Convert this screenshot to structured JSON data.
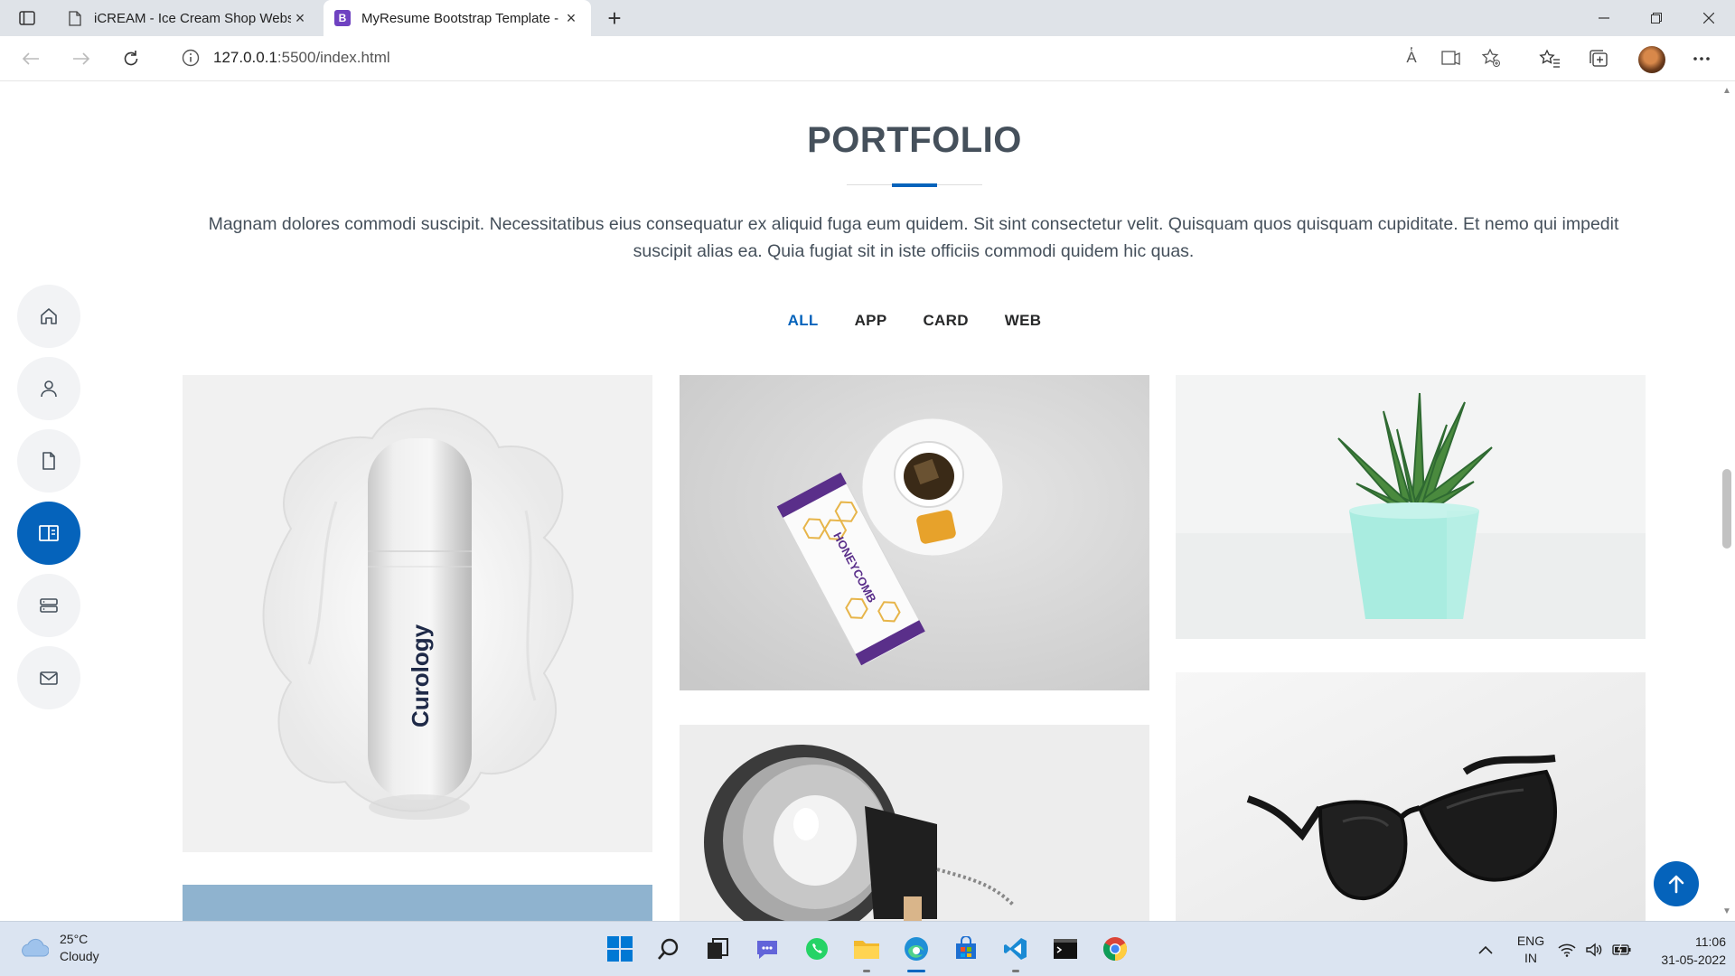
{
  "browser": {
    "tabs": [
      {
        "title": "iCREAM - Ice Cream Shop Websi",
        "favicon": "page-icon",
        "active": false
      },
      {
        "title": "MyResume Bootstrap Template -",
        "favicon": "bootstrap-icon",
        "favicon_letter": "B",
        "active": true
      }
    ],
    "new_tab_symbol": "+",
    "url_host": "127.0.0.1",
    "url_rest": ":5500/index.html",
    "read_aloud_symbol": "A̔"
  },
  "portfolio": {
    "title": "PORTFOLIO",
    "description": "Magnam dolores commodi suscipit. Necessitatibus eius consequatur ex aliquid fuga eum quidem. Sit sint consectetur velit. Quisquam quos quisquam cupiditate. Et nemo qui impedit suscipit alias ea. Quia fugiat sit in iste officiis commodi quidem hic quas.",
    "filters": [
      "ALL",
      "APP",
      "CARD",
      "WEB"
    ],
    "active_filter": "ALL",
    "items": [
      {
        "name": "curology-bottle",
        "label": "Curology"
      },
      {
        "name": "honeycomb-pack",
        "label": "HONEYCOMB"
      },
      {
        "name": "succulent-plant"
      },
      {
        "name": "desk-lamp"
      },
      {
        "name": "sunglasses"
      },
      {
        "name": "blue-card"
      }
    ],
    "accent_color": "#0563bb"
  },
  "sidenav": {
    "items": [
      {
        "name": "home",
        "icon": "home-icon"
      },
      {
        "name": "about",
        "icon": "person-icon"
      },
      {
        "name": "resume",
        "icon": "file-icon"
      },
      {
        "name": "portfolio",
        "icon": "book-half-icon",
        "active": true
      },
      {
        "name": "services",
        "icon": "server-icon"
      },
      {
        "name": "contact",
        "icon": "envelope-icon"
      }
    ]
  },
  "taskbar": {
    "weather_temp": "25°C",
    "weather_desc": "Cloudy",
    "lang_top": "ENG",
    "lang_bottom": "IN",
    "time": "11:06",
    "date": "31-05-2022"
  }
}
